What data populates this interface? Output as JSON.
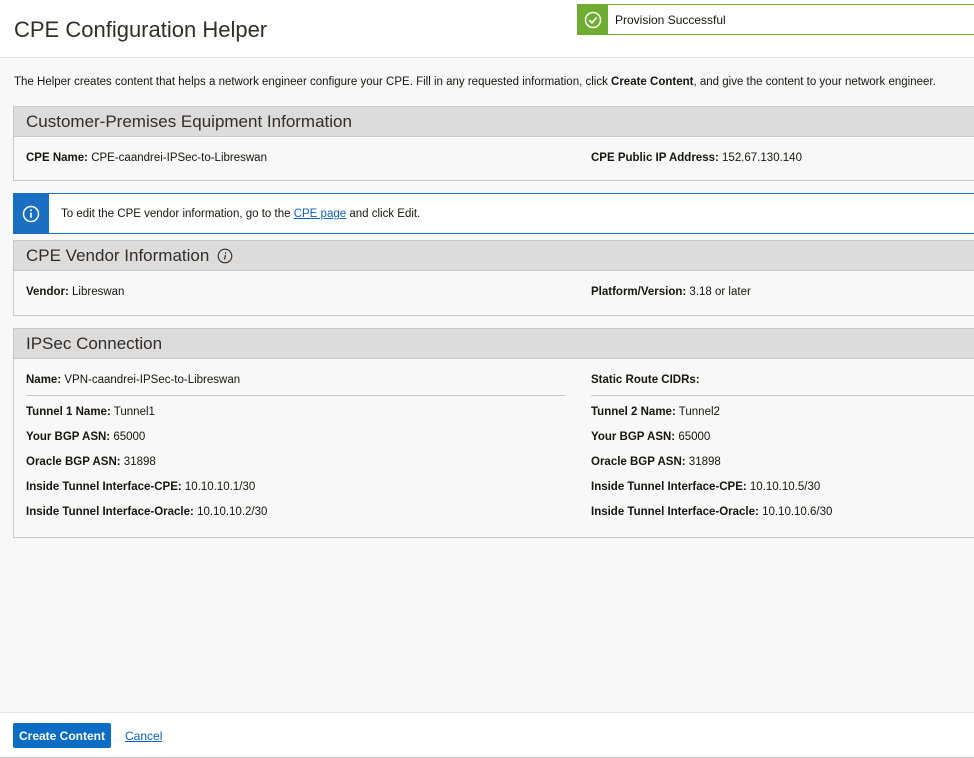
{
  "header": {
    "title": "CPE Configuration Helper"
  },
  "toast": {
    "message": "Provision Successful",
    "icon": "check-circle-icon",
    "accent": "#6ead2f"
  },
  "intro": {
    "text_before": "The Helper creates content that helps a network engineer configure your CPE. Fill in any requested information, click ",
    "bold": "Create Content",
    "text_after": ", and give the content to your network engineer."
  },
  "cpe_info": {
    "title": "Customer-Premises Equipment Information",
    "name_label": "CPE Name:",
    "name_value": "CPE-caandrei-IPSec-to-Libreswan",
    "ip_label": "CPE Public IP Address:",
    "ip_value": "152.67.130.140"
  },
  "info_banner": {
    "text_before": "To edit the CPE vendor information, go to the ",
    "link": "CPE page",
    "text_after": " and click Edit.",
    "icon": "info-icon",
    "accent": "#1b6fc3"
  },
  "vendor": {
    "title": "CPE Vendor Information",
    "vendor_label": "Vendor:",
    "vendor_value": "Libreswan",
    "platform_label": "Platform/Version:",
    "platform_value": "3.18 or later"
  },
  "ipsec": {
    "title": "IPSec Connection",
    "name_label": "Name:",
    "name_value": "VPN-caandrei-IPSec-to-Libreswan",
    "static_label": "Static Route CIDRs:",
    "tunnel1": {
      "name_label": "Tunnel 1 Name:",
      "name_value": "Tunnel1",
      "bgp_label": "Your BGP ASN:",
      "bgp_value": "65000",
      "oracle_label": "Oracle BGP ASN:",
      "oracle_value": "31898",
      "cpe_label": "Inside Tunnel Interface-CPE:",
      "cpe_value": "10.10.10.1/30",
      "oci_label": "Inside Tunnel Interface-Oracle:",
      "oci_value": "10.10.10.2/30"
    },
    "tunnel2": {
      "name_label": "Tunnel 2 Name:",
      "name_value": "Tunnel2",
      "bgp_label": "Your BGP ASN:",
      "bgp_value": "65000",
      "oracle_label": "Oracle BGP ASN:",
      "oracle_value": "31898",
      "cpe_label": "Inside Tunnel Interface-CPE:",
      "cpe_value": "10.10.10.5/30",
      "oci_label": "Inside Tunnel Interface-Oracle:",
      "oci_value": "10.10.10.6/30"
    }
  },
  "footer": {
    "primary_label": "Create Content",
    "cancel_label": "Cancel",
    "primary_color": "#0b6cc3"
  }
}
